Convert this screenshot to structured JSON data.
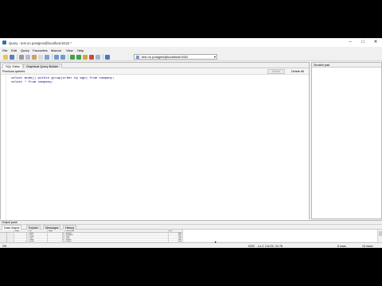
{
  "window": {
    "title": "Query - test on postgres@localhost:5432 *",
    "controls": {
      "minimize": "–",
      "maximize": "□",
      "close": "✕"
    }
  },
  "menu": [
    "File",
    "Edit",
    "Query",
    "Favourites",
    "Macros",
    "View",
    "Help"
  ],
  "toolbar": {
    "icons": [
      "open-file-icon",
      "save-file-icon",
      "cut-icon",
      "copy-icon",
      "paste-icon",
      "clear-icon",
      "find-icon",
      "undo-icon",
      "redo-icon",
      "execute-icon",
      "execute-file-icon",
      "explain-icon",
      "cancel-query-icon",
      "explain-analyze-icon",
      "help-icon"
    ],
    "connection": "test on postgres@localhost:5432"
  },
  "editor": {
    "tabs": [
      "SQL Editor",
      "Graphical Query Builder"
    ],
    "previous_queries_label": "Previous queries",
    "delete_label": "Delete",
    "delete_all_label": "Delete All",
    "lines": [
      "select mode() within group(order by age) from company;",
      "select * from company;"
    ]
  },
  "scratch_pad": {
    "label": "Scratch pad"
  },
  "output": {
    "header": "Output pane",
    "tabs": [
      "Data Output",
      "Explain",
      "Messages",
      "History"
    ],
    "columns": [
      {
        "name": "id",
        "type": "integer"
      },
      {
        "name": "name",
        "type": "text"
      },
      {
        "name": "age",
        "type": "integer"
      },
      {
        "name": "address",
        "type": "character(50)"
      },
      {
        "name": "salary",
        "type": "real"
      }
    ],
    "rows": [
      [
        "1",
        "1",
        "Meeta",
        "24",
        "Mumbai",
        "4000"
      ],
      [
        "2",
        "4",
        "Sashi",
        "24",
        "Bangalore",
        "4000"
      ],
      [
        "3",
        "5",
        "Kumar",
        "24",
        "Delhi",
        "2000"
      ],
      [
        "4",
        "6",
        "Priya",
        "24",
        "Delhi",
        "3000"
      ],
      [
        "5",
        "7",
        "Ramul",
        "24",
        "Kolkata",
        "5000"
      ],
      [
        "6",
        "11",
        "Vinyay",
        "24",
        "Kolkata",
        "5000"
      ]
    ]
  },
  "status": {
    "left": "OK.",
    "encoding": "DOS",
    "position": "Ln 2, Col 23, Ch 76",
    "rows": "6 rows.",
    "time": "13 msec"
  }
}
